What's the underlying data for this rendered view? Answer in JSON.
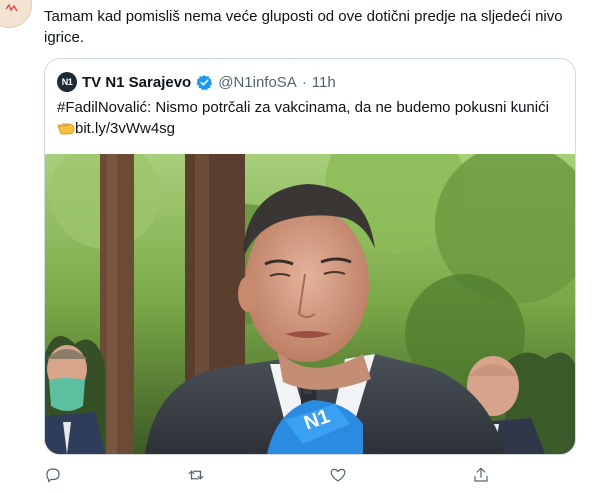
{
  "tweet": {
    "text": "Tamam kad pomisliš nema veće gluposti od ove dotični predje na sljedeći nivo igrice."
  },
  "quoted_tweet": {
    "display_name": "TV N1 Sarajevo",
    "handle": "@N1infoSA",
    "separator": "·",
    "time": "11h",
    "logo_text": "N1",
    "hashtag": "#FadilNovalić",
    "text": ": Nismo potrčali za vakcinama, da ne budemo pokusni kunići",
    "link": "bit.ly/3vWw4sg",
    "mic_label": "N1"
  },
  "actions": {
    "icons": [
      "reply-icon",
      "retweet-icon",
      "like-icon",
      "share-icon"
    ]
  },
  "colors": {
    "text": "#0f1419",
    "secondary": "#536471",
    "border": "#cfd9de",
    "verified": "#1d9bf0"
  }
}
